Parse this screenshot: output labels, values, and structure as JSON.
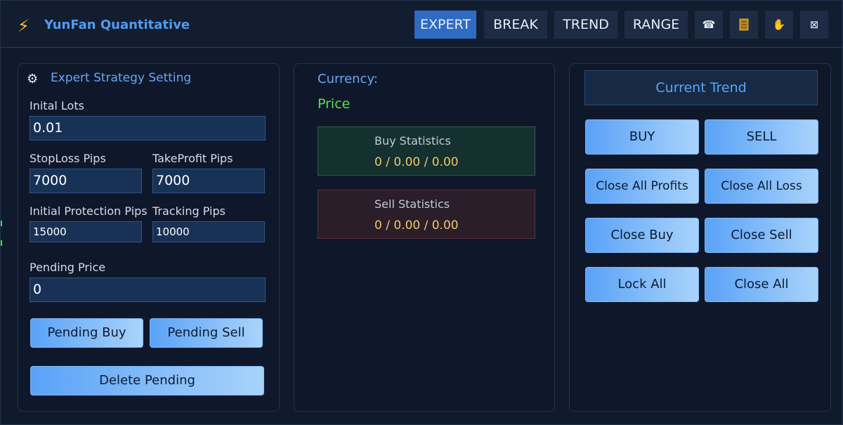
{
  "app": {
    "title": "YunFan Quantitative",
    "logo_icon": "lightning-icon"
  },
  "header": {
    "tabs": [
      {
        "label": "EXPERT",
        "active": true
      },
      {
        "label": "BREAK",
        "active": false
      },
      {
        "label": "TREND",
        "active": false
      },
      {
        "label": "RANGE",
        "active": false
      }
    ],
    "icon_buttons": [
      "phone-icon",
      "book-icon",
      "hand-icon",
      "close-box-icon"
    ]
  },
  "settings": {
    "title": "Expert Strategy Setting",
    "initial_lots_label": "Inital Lots",
    "initial_lots_value": "0.01",
    "stoploss_label": "StopLoss Pips",
    "stoploss_value": "7000",
    "takeprofit_label": "TakeProfit Pips",
    "takeprofit_value": "7000",
    "initial_protection_label": "Initial Protection Pips",
    "initial_protection_value": "15000",
    "tracking_label": "Tracking Pips",
    "tracking_value": "10000",
    "pending_price_label": "Pending Price",
    "pending_price_value": "0",
    "pending_buy_label": "Pending Buy",
    "pending_sell_label": "Pending Sell",
    "delete_pending_label": "Delete Pending"
  },
  "market": {
    "currency_label": "Currency:",
    "price_label": "Price",
    "buy_stats_title": "Buy Statistics",
    "buy_stats_value": "0 / 0.00 / 0.00",
    "sell_stats_title": "Sell Statistics",
    "sell_stats_value": "0 / 0.00 / 0.00"
  },
  "actions": {
    "trend_label": "Current Trend",
    "buy_label": "BUY",
    "sell_label": "SELL",
    "close_all_profits_label": "Close All Profits",
    "close_all_loss_label": "Close All Loss",
    "close_buy_label": "Close Buy",
    "close_sell_label": "Close Sell",
    "lock_all_label": "Lock All",
    "close_all_label": "Close All"
  },
  "colors": {
    "background": "#101a2d",
    "accent": "#2f6bc2",
    "title_blue": "#4f9cf0",
    "price_green": "#58e24c",
    "stat_value": "#f2c66a"
  }
}
